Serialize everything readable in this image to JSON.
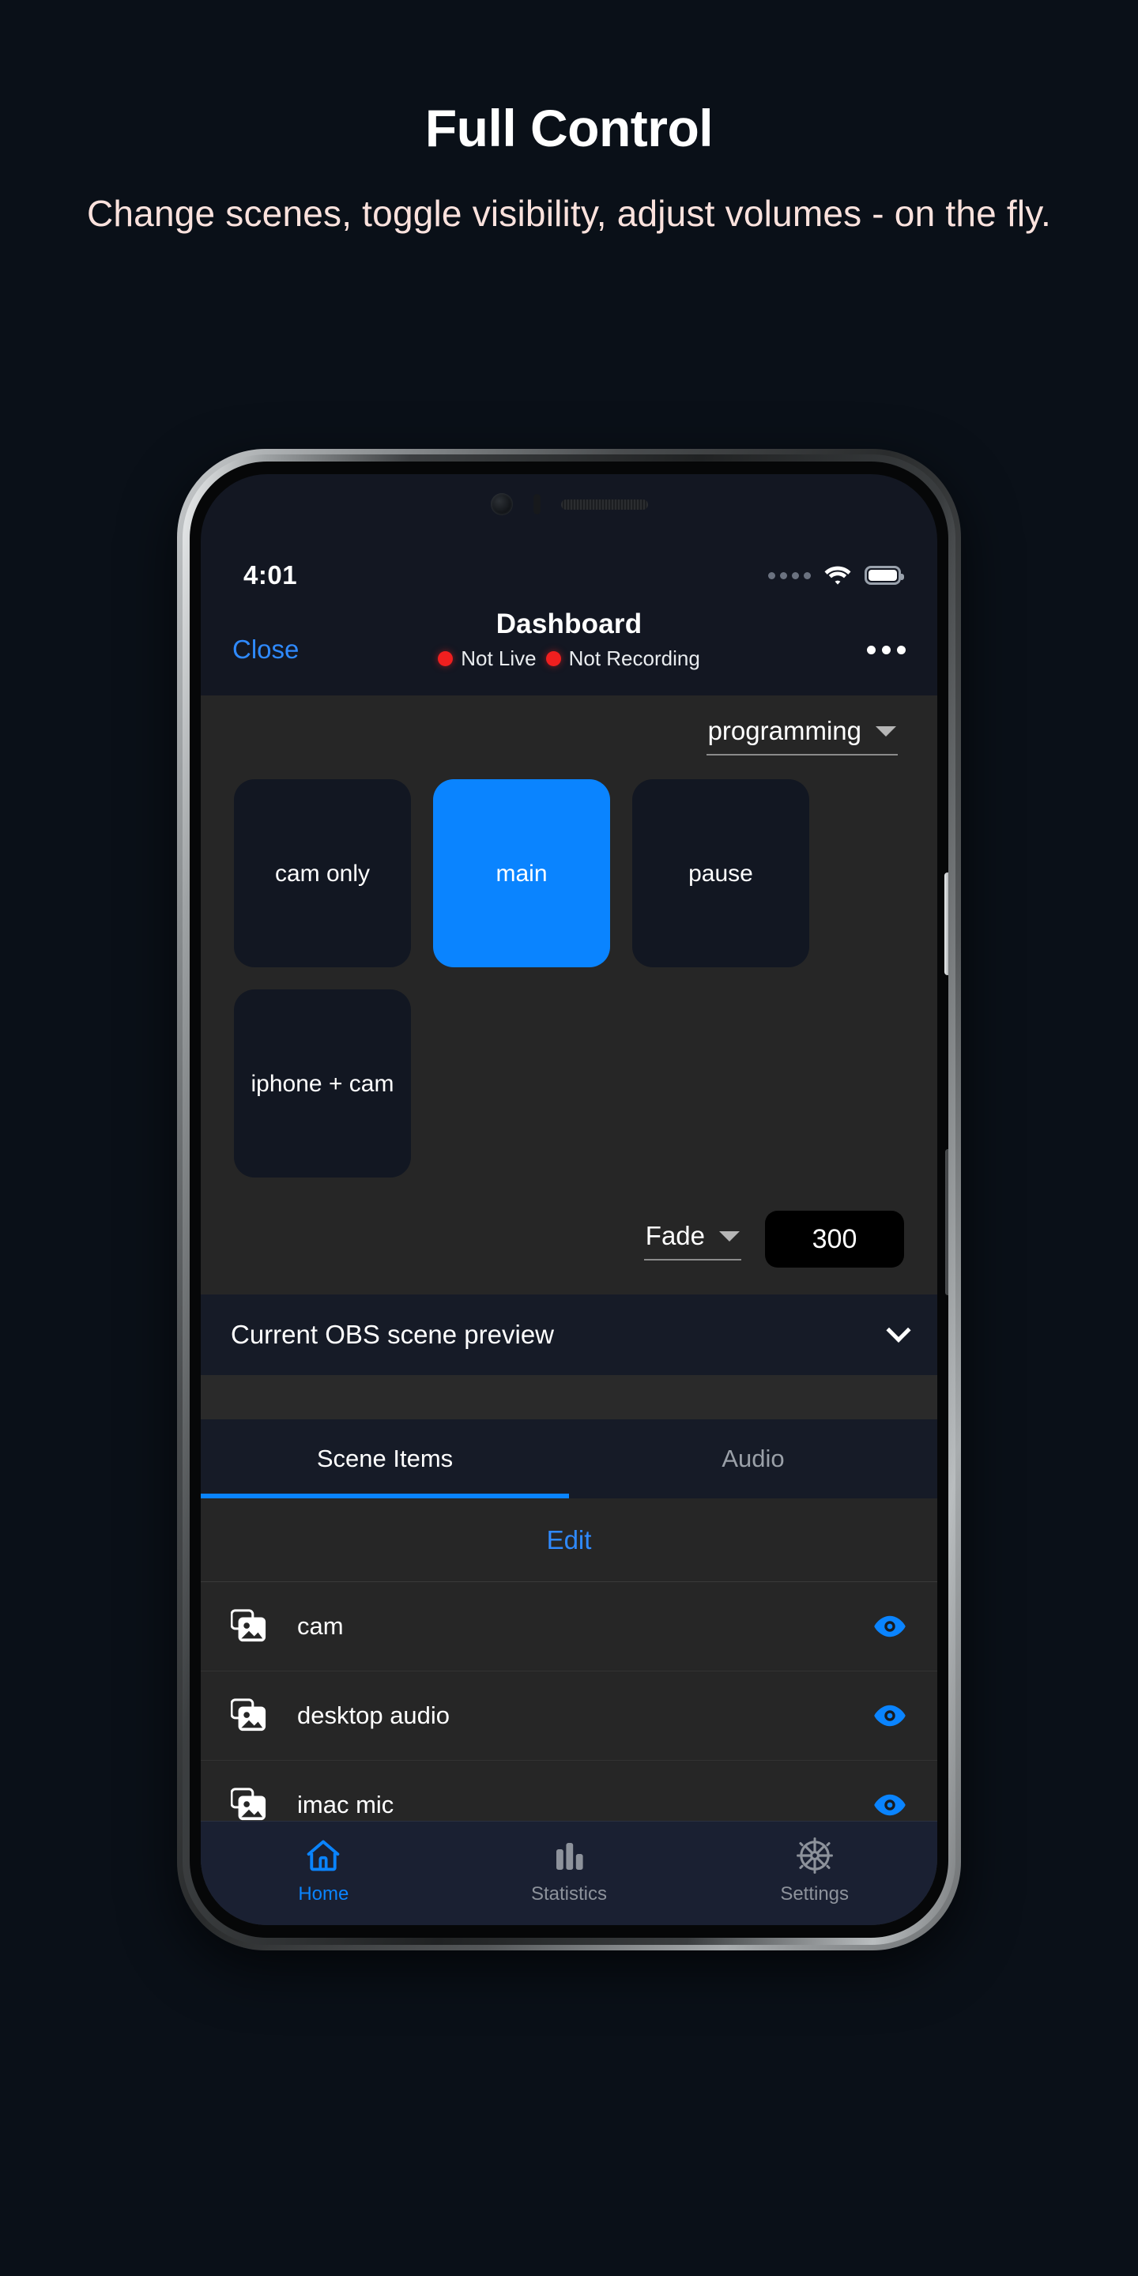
{
  "promo": {
    "title": "Full Control",
    "subtitle": "Change scenes, toggle visibility, adjust volumes - on the fly."
  },
  "colors": {
    "page_background": "#0a1018",
    "accent_blue": "#0a84ff",
    "link_blue": "#2f8aff",
    "status_red": "#f01f1f",
    "panel_dark": "#262626",
    "app_background": "#131722",
    "subtitle_cream": "#fbe2dd"
  },
  "phone": {
    "status_bar": {
      "time": "4:01",
      "signal_icon": "signal-dots-icon",
      "wifi_icon": "wifi-icon",
      "battery_icon": "battery-full-icon"
    },
    "nav_bar": {
      "close_label": "Close",
      "title": "Dashboard",
      "live_status": "Not Live",
      "recording_status": "Not Recording",
      "more_icon": "more-horizontal-icon"
    },
    "scenes_panel": {
      "collection_selected": "programming",
      "collection_caret_icon": "caret-down-icon",
      "tiles": [
        {
          "label": "cam only",
          "active": false
        },
        {
          "label": "main",
          "active": true
        },
        {
          "label": "pause",
          "active": false
        },
        {
          "label": "iphone + cam",
          "active": false
        }
      ],
      "transition_name": "Fade",
      "transition_caret_icon": "caret-down-icon",
      "transition_duration": "300"
    },
    "preview": {
      "title": "Current OBS scene preview",
      "chevron_icon": "chevron-down-icon"
    },
    "tabs": [
      {
        "label": "Scene Items",
        "active": true
      },
      {
        "label": "Audio",
        "active": false
      }
    ],
    "edit_label": "Edit",
    "sources": [
      {
        "name": "cam",
        "icon": "image-stack-icon",
        "visibility_icon": "eye-icon",
        "visible": true
      },
      {
        "name": "desktop audio",
        "icon": "image-stack-icon",
        "visibility_icon": "eye-icon",
        "visible": true
      },
      {
        "name": "imac mic",
        "icon": "image-stack-icon",
        "visibility_icon": "eye-icon",
        "visible": true
      }
    ],
    "tab_bar": [
      {
        "label": "Home",
        "icon": "home-icon",
        "active": true
      },
      {
        "label": "Statistics",
        "icon": "bar-chart-icon",
        "active": false
      },
      {
        "label": "Settings",
        "icon": "gear-icon",
        "active": false
      }
    ]
  }
}
